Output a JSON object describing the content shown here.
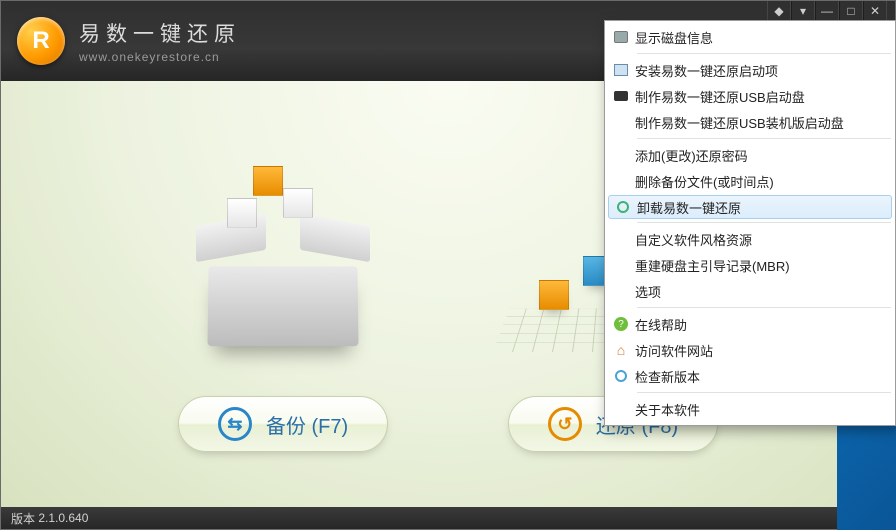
{
  "app": {
    "title": "易数一键还原",
    "url": "www.onekeyrestore.cn",
    "logo_letter": "R"
  },
  "window_controls": {
    "skin": "◆",
    "menu": "▾",
    "minimize": "—",
    "maximize": "□",
    "close": "✕"
  },
  "actions": {
    "backup": {
      "label": "备份",
      "hotkey": "(F7)"
    },
    "restore": {
      "label": "还原",
      "hotkey": "(F8)"
    }
  },
  "menu": {
    "items": [
      {
        "icon": "disk",
        "label": "显示磁盘信息"
      },
      {
        "sep": true
      },
      {
        "icon": "pc",
        "label": "安装易数一键还原启动项"
      },
      {
        "icon": "usb",
        "label": "制作易数一键还原USB启动盘"
      },
      {
        "icon": "",
        "label": "制作易数一键还原USB装机版启动盘"
      },
      {
        "sep": true
      },
      {
        "icon": "",
        "label": "添加(更改)还原密码"
      },
      {
        "icon": "",
        "label": "删除备份文件(或时间点)"
      },
      {
        "icon": "recycle",
        "label": "卸载易数一键还原",
        "highlight": true
      },
      {
        "sep": true
      },
      {
        "icon": "",
        "label": "自定义软件风格资源"
      },
      {
        "icon": "",
        "label": "重建硬盘主引导记录(MBR)"
      },
      {
        "icon": "",
        "label": "选项"
      },
      {
        "sep": true
      },
      {
        "icon": "help",
        "label": "在线帮助"
      },
      {
        "icon": "home",
        "label": "访问软件网站"
      },
      {
        "icon": "check",
        "label": "检查新版本"
      },
      {
        "sep": true
      },
      {
        "icon": "",
        "label": "关于本软件"
      }
    ]
  },
  "statusbar": {
    "version_label": "版本",
    "version": "2.1.0.640"
  }
}
